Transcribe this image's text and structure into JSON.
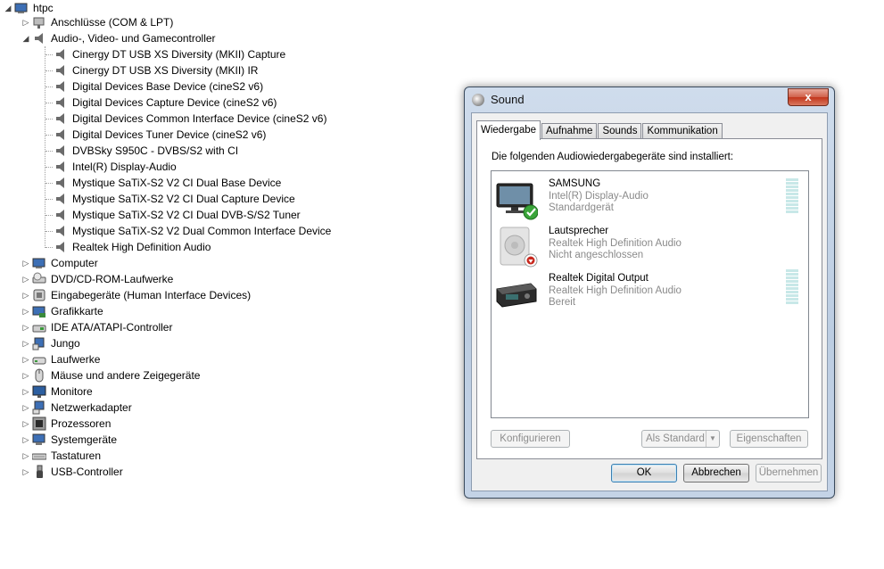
{
  "tree": {
    "root": "htpc",
    "nodes": [
      {
        "label": "Anschlüsse (COM & LPT)",
        "icon": "port-icon",
        "expanded": false
      },
      {
        "label": "Audio-, Video- und Gamecontroller",
        "icon": "speaker-icon",
        "expanded": true,
        "children": [
          "Cinergy DT USB XS Diversity (MKII) Capture",
          "Cinergy DT USB XS Diversity (MKII) IR",
          "Digital Devices Base Device (cineS2 v6)",
          "Digital Devices Capture Device (cineS2 v6)",
          "Digital Devices Common Interface Device (cineS2 v6)",
          "Digital Devices Tuner Device (cineS2 v6)",
          "DVBSky S950C - DVBS/S2 with CI",
          "Intel(R) Display-Audio",
          "Mystique SaTiX-S2 V2 CI Dual Base Device",
          "Mystique SaTiX-S2 V2 CI Dual Capture Device",
          "Mystique SaTiX-S2 V2 CI Dual DVB-S/S2 Tuner",
          "Mystique SaTiX-S2 V2 Dual Common Interface Device",
          "Realtek High Definition Audio"
        ]
      },
      {
        "label": "Computer",
        "icon": "computer-icon",
        "expanded": false
      },
      {
        "label": "DVD/CD-ROM-Laufwerke",
        "icon": "dvd-drive-icon",
        "expanded": false
      },
      {
        "label": "Eingabegeräte (Human Interface Devices)",
        "icon": "hid-icon",
        "expanded": false
      },
      {
        "label": "Grafikkarte",
        "icon": "display-adapter-icon",
        "expanded": false
      },
      {
        "label": "IDE ATA/ATAPI-Controller",
        "icon": "ide-controller-icon",
        "expanded": false
      },
      {
        "label": "Jungo",
        "icon": "jungo-icon",
        "expanded": false
      },
      {
        "label": "Laufwerke",
        "icon": "disk-drive-icon",
        "expanded": false
      },
      {
        "label": "Mäuse und andere Zeigegeräte",
        "icon": "mouse-icon",
        "expanded": false
      },
      {
        "label": "Monitore",
        "icon": "monitor-icon",
        "expanded": false
      },
      {
        "label": "Netzwerkadapter",
        "icon": "network-adapter-icon",
        "expanded": false
      },
      {
        "label": "Prozessoren",
        "icon": "processor-icon",
        "expanded": false
      },
      {
        "label": "Systemgeräte",
        "icon": "system-device-icon",
        "expanded": false
      },
      {
        "label": "Tastaturen",
        "icon": "keyboard-icon",
        "expanded": false
      },
      {
        "label": "USB-Controller",
        "icon": "usb-icon",
        "expanded": false
      }
    ]
  },
  "dialog": {
    "title": "Sound",
    "close_label": "x",
    "tabs": [
      "Wiedergabe",
      "Aufnahme",
      "Sounds",
      "Kommunikation"
    ],
    "active_tab": "Wiedergabe",
    "description": "Die folgenden Audiowiedergabegeräte sind installiert:",
    "devices": [
      {
        "name": "SAMSUNG",
        "driver": "Intel(R) Display-Audio",
        "state": "Standardgerät",
        "icon": "tv-icon",
        "badge": "default-check-icon",
        "meter": true
      },
      {
        "name": "Lautsprecher",
        "driver": "Realtek High Definition Audio",
        "state": "Nicht angeschlossen",
        "icon": "speaker-icon",
        "badge": "unplugged-icon",
        "meter": false
      },
      {
        "name": "Realtek Digital Output",
        "driver": "Realtek High Definition Audio",
        "state": "Bereit",
        "icon": "digital-output-icon",
        "badge": "",
        "meter": true
      }
    ],
    "buttons": {
      "configure": "Konfigurieren",
      "set_default": "Als Standard",
      "properties": "Eigenschaften",
      "ok": "OK",
      "cancel": "Abbrechen",
      "apply": "Übernehmen"
    }
  },
  "colors": {
    "dialog_frame": "#bccde2",
    "close_button": "#c7412a",
    "check_green": "#3aa53a",
    "unplugged_red": "#c8281e",
    "meter": "#c8e8e8"
  }
}
